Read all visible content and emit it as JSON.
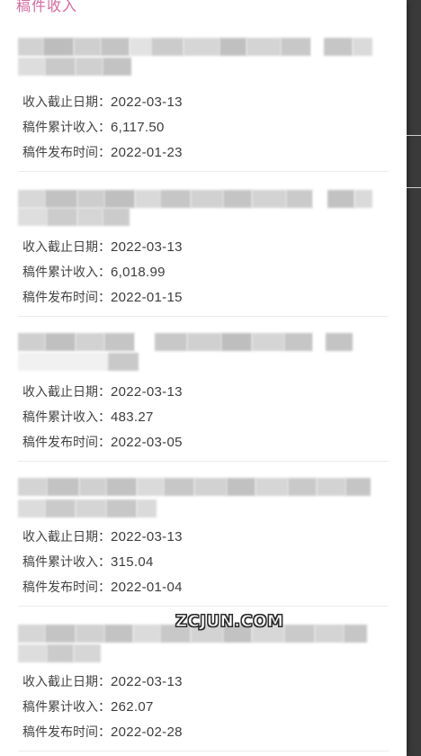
{
  "header": {
    "title": "稿件收入"
  },
  "labels": {
    "deadline": "收入截止日期：",
    "total_income": "稿件累计收入：",
    "publish_time": "稿件发布时间："
  },
  "articles": [
    {
      "deadline": "2022-03-13",
      "total_income": "6,117.50",
      "publish_time": "2022-01-23"
    },
    {
      "deadline": "2022-03-13",
      "total_income": "6,018.99",
      "publish_time": "2022-01-15"
    },
    {
      "deadline": "2022-03-13",
      "total_income": "483.27",
      "publish_time": "2022-03-05"
    },
    {
      "deadline": "2022-03-13",
      "total_income": "315.04",
      "publish_time": "2022-01-04"
    },
    {
      "deadline": "2022-03-13",
      "total_income": "262.07",
      "publish_time": "2022-02-28"
    }
  ],
  "watermark": "ZCJUN.COM",
  "colors": {
    "title_pink": "#d76aa0",
    "text_gray": "#444444",
    "divider": "#ececec"
  }
}
